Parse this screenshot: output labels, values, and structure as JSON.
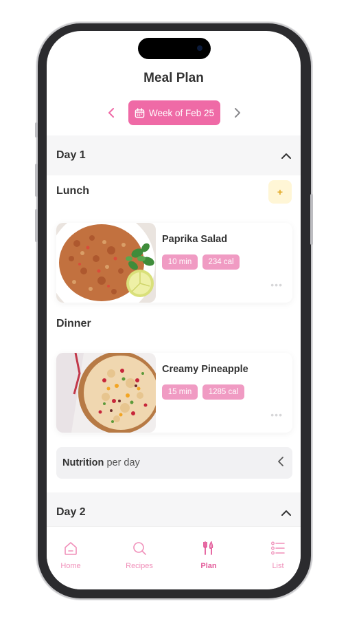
{
  "header": {
    "title": "Meal Plan"
  },
  "week": {
    "label": "Week of Feb 25"
  },
  "days": [
    {
      "title": "Day 1",
      "meals": [
        {
          "type": "Lunch",
          "name": "Paprika Salad",
          "time": "10 min",
          "calories": "234 cal"
        },
        {
          "type": "Dinner",
          "name": "Creamy Pineapple",
          "time": "15 min",
          "calories": "1285 cal"
        }
      ],
      "add_label": "+",
      "more_label": "•••"
    },
    {
      "title": "Day 2"
    }
  ],
  "nutrition": {
    "bold_label": "Nutrition",
    "suffix": "per day"
  },
  "tabs": [
    {
      "label": "Home",
      "icon": "home-icon"
    },
    {
      "label": "Recipes",
      "icon": "search-icon"
    },
    {
      "label": "Plan",
      "icon": "utensils-icon"
    },
    {
      "label": "List",
      "icon": "list-icon"
    }
  ],
  "colors": {
    "accent": "#ef6aa6",
    "tag_bg": "#f09bc3",
    "add_bg": "#fff6d6",
    "add_fg": "#e2a824",
    "header_bg": "#f6f6f7"
  }
}
